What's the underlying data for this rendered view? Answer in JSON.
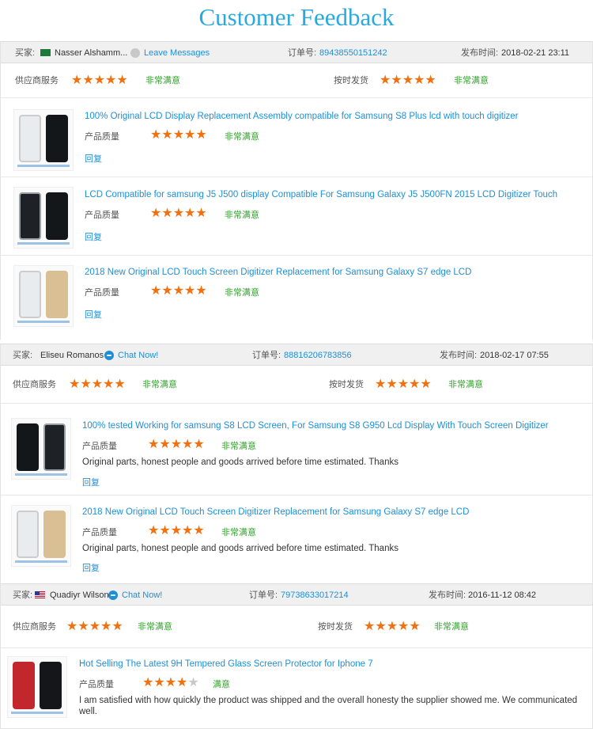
{
  "page": {
    "title": "Customer Feedback"
  },
  "labels": {
    "buyer": "买家:",
    "order_no": "订单号:",
    "published": "发布时间:",
    "supplier_service": "供应商服务",
    "shipping": "按时发货",
    "quality": "产品质量",
    "reply": "回复"
  },
  "reviews": [
    {
      "buyer": "Nasser Alshamm...",
      "action": "Leave Messages",
      "order_no": "89438550151242",
      "time": "2018-02-21 23:11",
      "supplier_rating": 5,
      "supplier_text": "非常满意",
      "shipping_rating": 5,
      "shipping_text": "非常满意",
      "items": [
        {
          "title": "100% Original LCD Display Replacement Assembly compatible for Samsung S8 Plus lcd with touch digitizer",
          "rating": 5,
          "rating_text": "非常满意",
          "comment": ""
        },
        {
          "title": "LCD Compatible for samsung J5 J500 display Compatible For Samsung Galaxy J5 J500FN 2015 LCD Digitizer Touch",
          "rating": 5,
          "rating_text": "非常满意",
          "comment": ""
        },
        {
          "title": "2018 New Original LCD Touch Screen Digitizer Replacement for Samsung Galaxy S7 edge LCD",
          "rating": 5,
          "rating_text": "非常满意",
          "comment": ""
        }
      ]
    },
    {
      "buyer": "Eliseu Romanos",
      "action": "Chat Now!",
      "order_no": "88816206783856",
      "time": "2018-02-17 07:55",
      "supplier_rating": 5,
      "supplier_text": "非常满意",
      "shipping_rating": 5,
      "shipping_text": "非常满意",
      "items": [
        {
          "title": "100% tested Working for samsung S8 LCD Screen, For Samsung S8 G950 Lcd Display With Touch Screen Digitizer",
          "rating": 5,
          "rating_text": "非常满意",
          "comment": "Original parts, honest people and goods arrived before time estimated. Thanks"
        },
        {
          "title": "2018 New Original LCD Touch Screen Digitizer Replacement for Samsung Galaxy S7 edge LCD",
          "rating": 5,
          "rating_text": "非常满意",
          "comment": "Original parts, honest people and goods arrived before time estimated. Thanks"
        }
      ]
    },
    {
      "buyer": "Quadiyr Wilson",
      "action": "Chat Now!",
      "order_no": "79738633017214",
      "time": "2016-11-12 08:42",
      "supplier_rating": 5,
      "supplier_text": "非常满意",
      "shipping_rating": 5,
      "shipping_text": "非常满意",
      "items": [
        {
          "title": "Hot Selling The Latest 9H Tempered Glass Screen Protector for Iphone 7",
          "rating": 4,
          "rating_text": "满意",
          "comment_line1": "I am satisfied with how quickly the product was shipped and the overall honesty the supplier showed me. We communicated",
          "comment_line2": "well."
        }
      ]
    }
  ],
  "colors": {
    "accent": "#1e8fd6",
    "star": "#f3700f",
    "satisfied": "#33a02c",
    "title": "#29a9e0"
  }
}
